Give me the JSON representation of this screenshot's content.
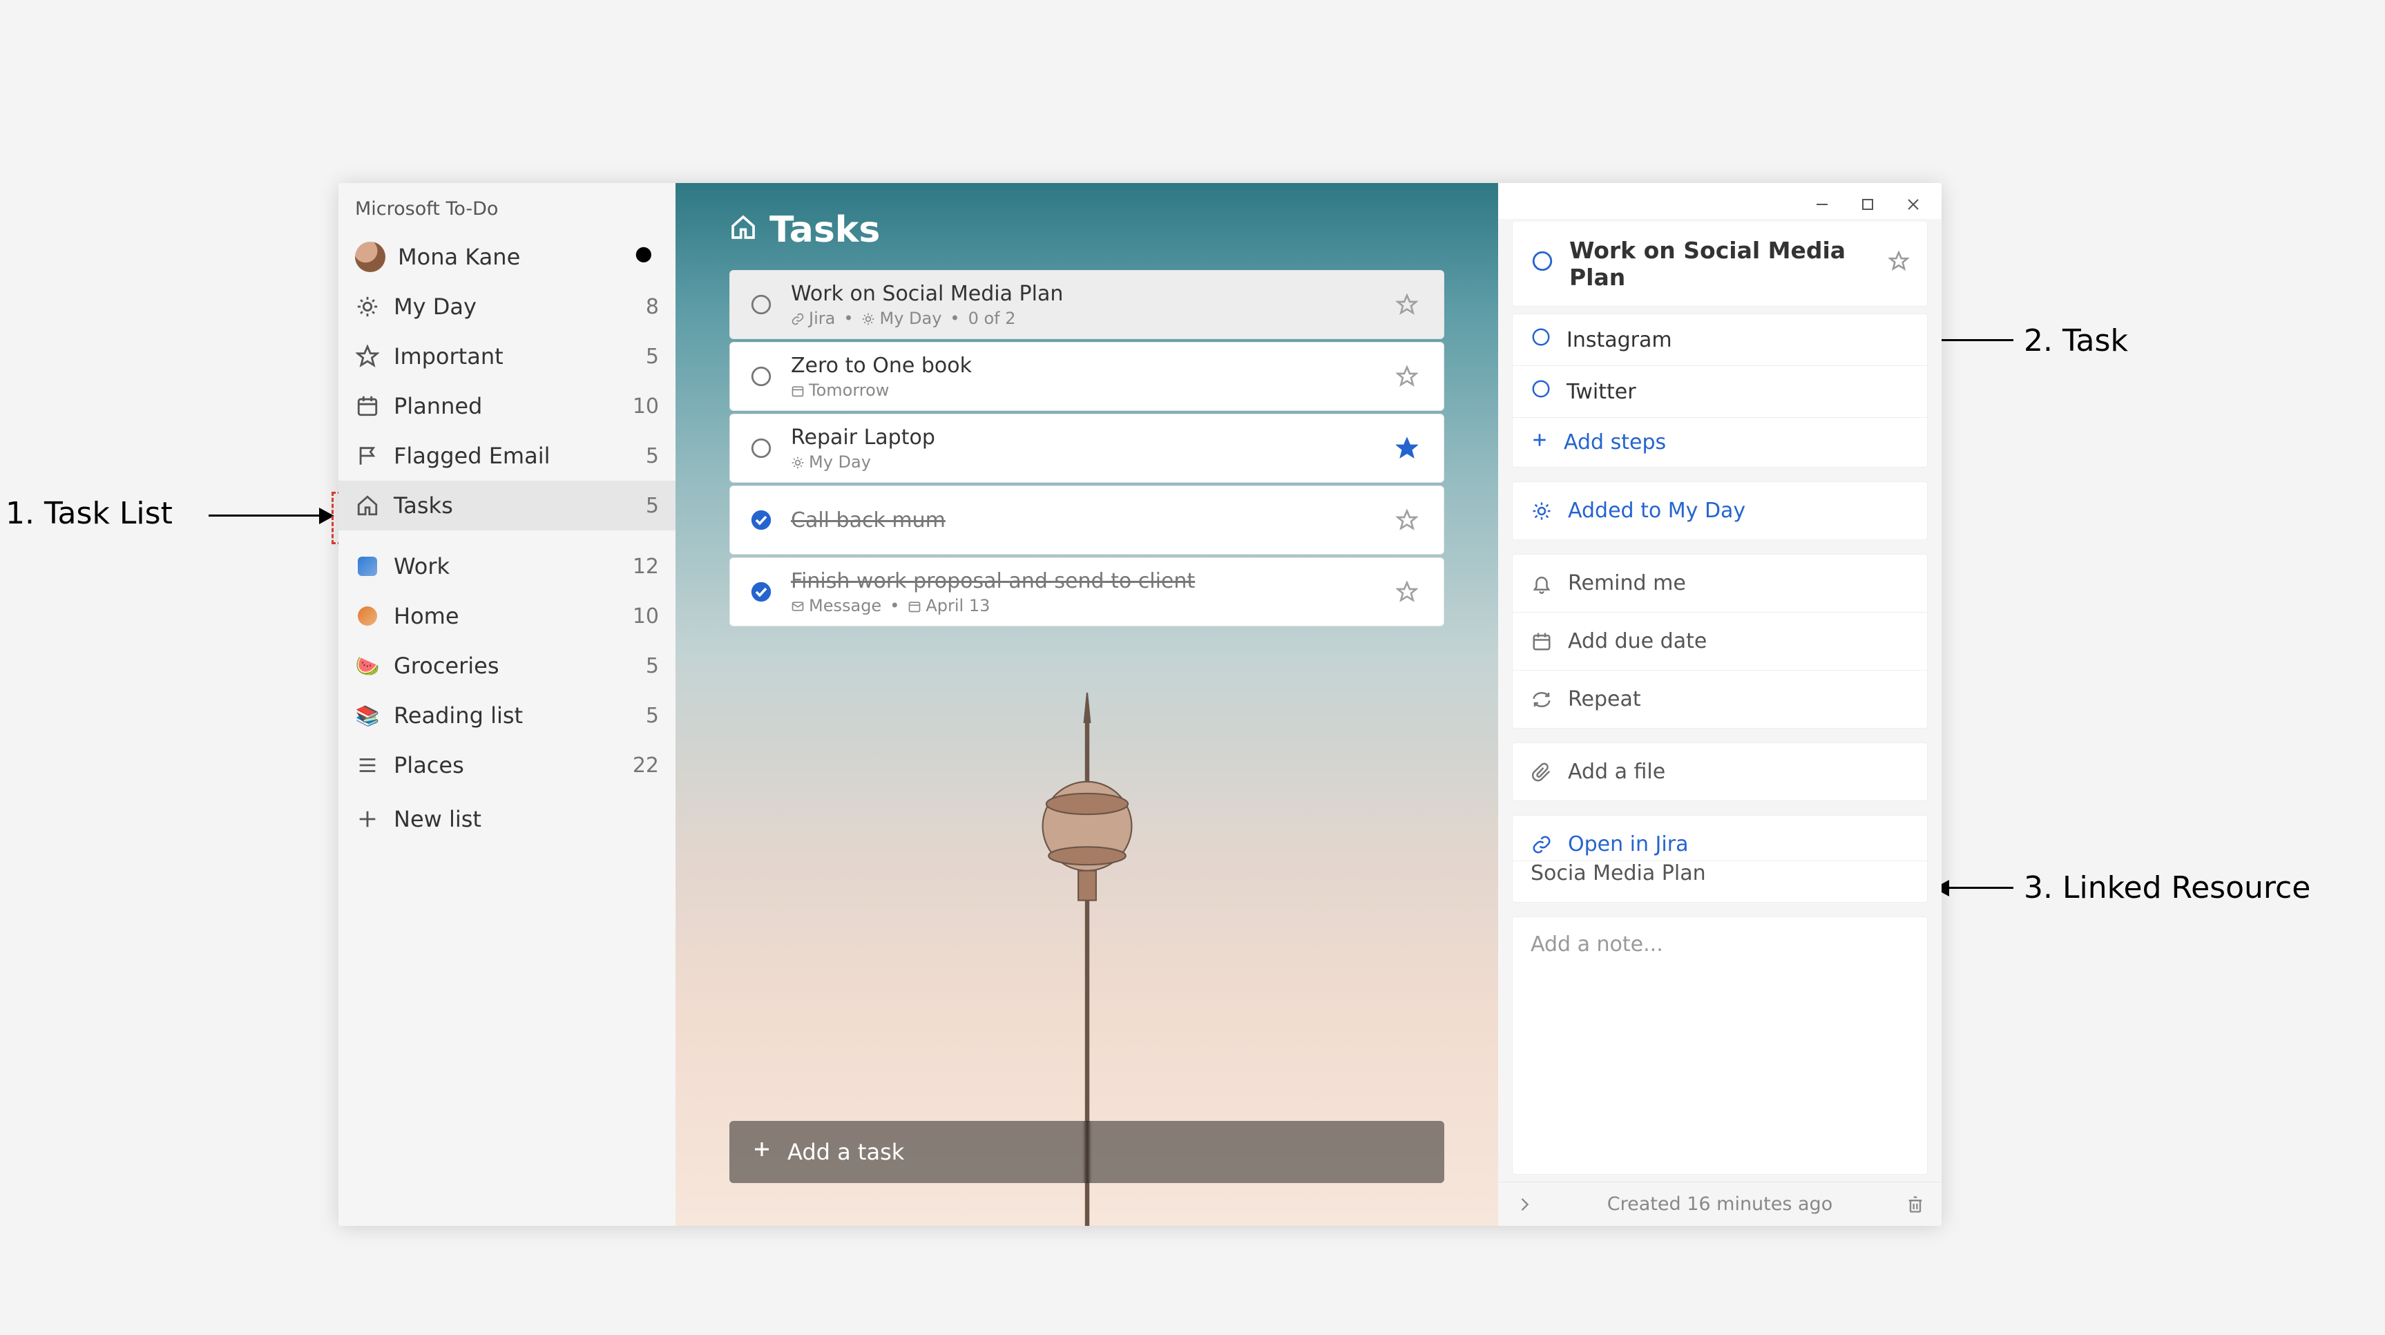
{
  "appName": "Microsoft To-Do",
  "user": {
    "name": "Mona Kane"
  },
  "sidebar": {
    "smart": [
      {
        "id": "myday",
        "label": "My Day",
        "count": 8
      },
      {
        "id": "important",
        "label": "Important",
        "count": 5
      },
      {
        "id": "planned",
        "label": "Planned",
        "count": 10
      },
      {
        "id": "flagged",
        "label": "Flagged Email",
        "count": 5
      },
      {
        "id": "tasks",
        "label": "Tasks",
        "count": 5
      }
    ],
    "custom": [
      {
        "id": "work",
        "label": "Work",
        "count": 12
      },
      {
        "id": "home",
        "label": "Home",
        "count": 10
      },
      {
        "id": "groceries",
        "label": "Groceries",
        "count": 5
      },
      {
        "id": "reading",
        "label": "Reading list",
        "count": 5
      },
      {
        "id": "places",
        "label": "Places",
        "count": 22
      }
    ],
    "newList": "New list"
  },
  "main": {
    "title": "Tasks",
    "addTask": "Add a task",
    "tasks": [
      {
        "id": "t1",
        "title": "Work on Social Media Plan",
        "completed": false,
        "starred": false,
        "selected": true,
        "meta": [
          {
            "icon": "link",
            "text": "Jira"
          },
          {
            "icon": "sun",
            "text": "My Day"
          },
          {
            "text": "0 of 2"
          }
        ]
      },
      {
        "id": "t2",
        "title": "Zero to One book",
        "completed": false,
        "starred": false,
        "meta": [
          {
            "icon": "calendar",
            "text": "Tomorrow"
          }
        ]
      },
      {
        "id": "t3",
        "title": "Repair Laptop",
        "completed": false,
        "starred": true,
        "meta": [
          {
            "icon": "sun",
            "text": "My Day"
          }
        ]
      },
      {
        "id": "t4",
        "title": "Call back mum",
        "completed": true,
        "starred": false,
        "meta": []
      },
      {
        "id": "t5",
        "title": "Finish work proposal and send to client",
        "completed": true,
        "starred": false,
        "meta": [
          {
            "icon": "mail",
            "text": "Message"
          },
          {
            "icon": "calendar",
            "text": "April 13"
          }
        ]
      }
    ]
  },
  "detail": {
    "title": "Work on Social Media Plan",
    "steps": [
      "Instagram",
      "Twitter"
    ],
    "addSteps": "Add steps",
    "addedToMyDay": "Added to My Day",
    "remind": "Remind me",
    "due": "Add due date",
    "repeat": "Repeat",
    "file": "Add a file",
    "link": {
      "action": "Open in Jira",
      "target": "Socia Media Plan"
    },
    "notePlaceholder": "Add a note...",
    "created": "Created 16 minutes ago"
  },
  "callouts": {
    "one": "1. Task List",
    "two": "2. Task",
    "three": "3. Linked Resource"
  }
}
